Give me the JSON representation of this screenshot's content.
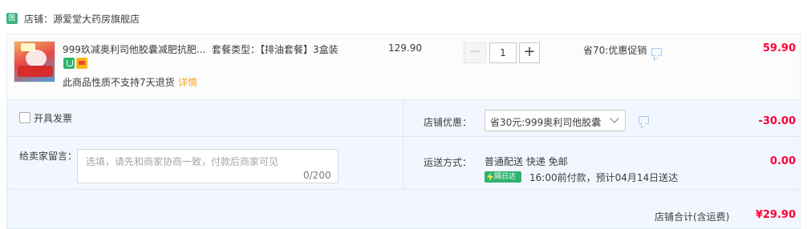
{
  "shop": {
    "badge": "医",
    "name": "店铺：源爱堂大药房旗舰店"
  },
  "item": {
    "title": "999玖减奥利司他胶囊减肥抗肥...",
    "icons": [
      "pharmacy-tag-icon",
      "card-tag-icon"
    ],
    "notice": "此商品性质不支持7天退货",
    "notice_link": "详情",
    "spec": "套餐类型：【排油套餐】3盒装",
    "unit_price": "129.90",
    "quantity": "1",
    "minus_label": "−",
    "plus_label": "+",
    "promo": "省70:优惠促销",
    "subtotal": "59.90"
  },
  "invoice": {
    "label": "开具发票"
  },
  "note": {
    "label": "给卖家留言：",
    "placeholder": "选填，请先和商家协商一致，付款后商家可见",
    "count": "0/200"
  },
  "discount": {
    "label": "店铺优惠：",
    "selected": "省30元:999奥利司他胶囊",
    "amount": "-30.00"
  },
  "shipping": {
    "label": "运送方式：",
    "method": "普通配送 快递 免邮",
    "badge": "隔日达",
    "eta": "16:00前付款，预计04月14日送达",
    "amount": "0.00"
  },
  "total": {
    "label": "店铺合计(含运费)",
    "amount": "¥29.90"
  },
  "colors": {
    "accent_red": "#ff0036",
    "panel_bg": "#f2f7ff",
    "badge_green": "#2fb36f",
    "link_orange": "#f5a623"
  }
}
